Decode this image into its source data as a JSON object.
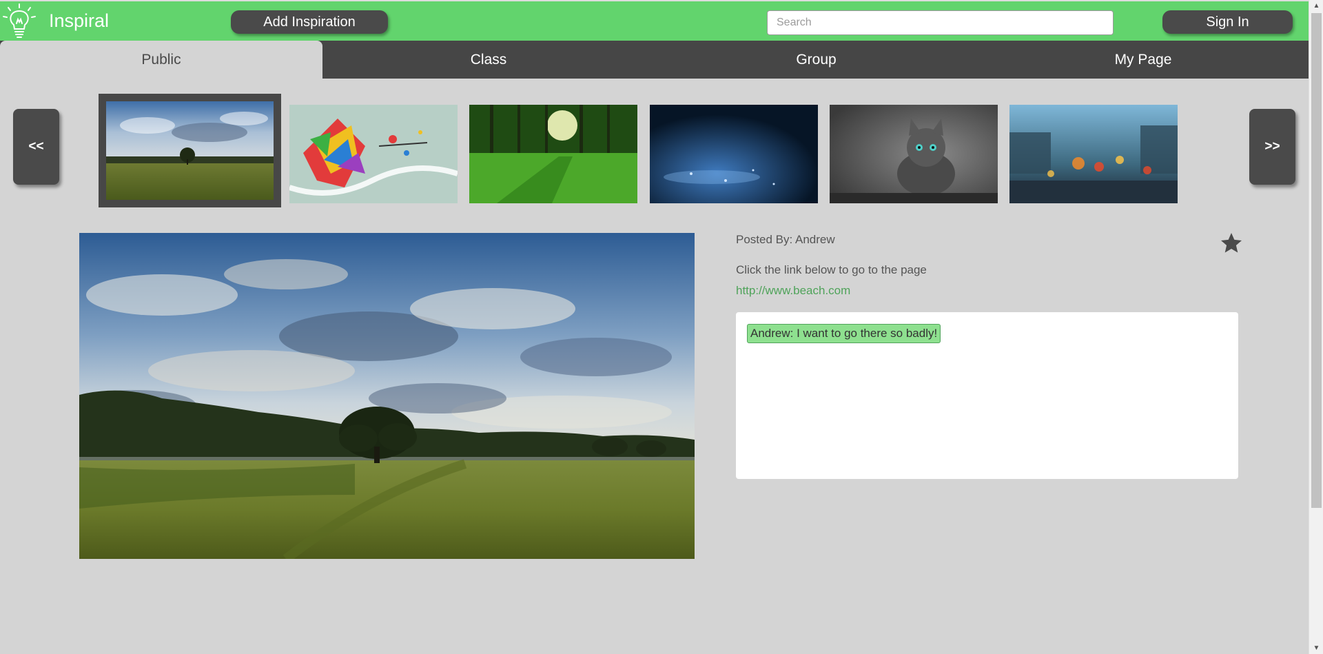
{
  "header": {
    "brand": "Inspiral",
    "logo_icon": "lightbulb-icon",
    "add_button": "Add Inspiration",
    "search_placeholder": "Search",
    "search_value": "",
    "signin_button": "Sign In",
    "color": "#62d46d"
  },
  "tabs": [
    {
      "label": "Public",
      "active": true
    },
    {
      "label": "Class",
      "active": false
    },
    {
      "label": "Group",
      "active": false
    },
    {
      "label": "My Page",
      "active": false
    }
  ],
  "carousel": {
    "prev_label": "<<",
    "next_label": ">>",
    "thumbnails": [
      {
        "subject": "field-with-tree",
        "selected": true
      },
      {
        "subject": "colorful-abstract-art",
        "selected": false
      },
      {
        "subject": "green-forest-sunlight",
        "selected": false
      },
      {
        "subject": "blue-rain-night",
        "selected": false
      },
      {
        "subject": "grey-kitten",
        "selected": false
      },
      {
        "subject": "rainy-window-city-lights",
        "selected": false
      }
    ]
  },
  "detail": {
    "posted_by": "Posted By: Andrew",
    "instruction": "Click the link below to go to the page",
    "link": "http://www.beach.com",
    "favorite_icon": "star-icon",
    "comments": [
      {
        "text": "Andrew: I want to go there so badly!"
      }
    ]
  },
  "colors": {
    "accent": "#62d46d",
    "dark": "#464646",
    "background": "#d4d4d4",
    "link": "#4fa35a"
  }
}
